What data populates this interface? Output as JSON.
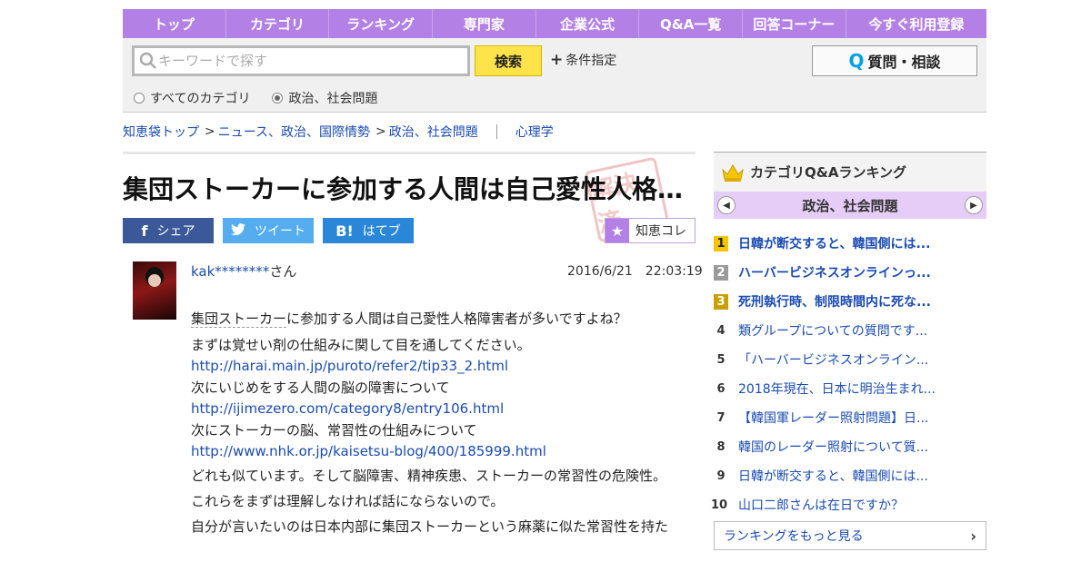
{
  "nav": {
    "items": [
      "トップ",
      "カテゴリ",
      "ランキング",
      "専門家",
      "企業公式",
      "Q&A一覧",
      "回答コーナー",
      "今すぐ利用登録"
    ]
  },
  "search": {
    "placeholder": "キーワードで探す",
    "button_label": "検索",
    "condition_label": "条件指定",
    "ask_button_label": "質問・相談",
    "scope_all": "すべてのカテゴリ",
    "scope_current": "政治、社会問題"
  },
  "breadcrumb": {
    "items": [
      "知恵袋トップ",
      "ニュース、政治、国際情勢",
      "政治、社会問題"
    ],
    "separator": ">",
    "related": "心理学"
  },
  "question": {
    "title": "集団ストーカーに参加する人間は自己愛性人格障害者が多いですよね？",
    "stamp_text": "解決済",
    "share": {
      "facebook": "シェア",
      "twitter": "ツイート",
      "hatena": "はてブ",
      "chiekore": "知恵コレ"
    },
    "user": "kak********",
    "user_suffix": "さん",
    "date": "2016/6/21　22:03:19",
    "lines": [
      {
        "text_a": "集団ストーカー",
        "text_b": "に参加する人間は自己愛性人格障害者が多いですよね？"
      },
      {
        "text": "まずは覚せい剤の仕組みに関して目を通してください。"
      },
      {
        "link": "http://harai.main.jp/puroto/refer2/tip33_2.html"
      },
      {
        "text": "次にいじめをする人間の脳の障害について"
      },
      {
        "link": "http://ijimezero.com/category8/entry106.html"
      },
      {
        "text": "次にストーカーの脳、常習性の仕組みについて"
      },
      {
        "link": "http://www.nhk.or.jp/kaisetsu-blog/400/185999.html"
      },
      {
        "text": "どれも似ています。そして脳障害、精神疾患、ストーカーの常習性の危険性。"
      },
      {
        "text": "これらをまずは理解しなければ話にならないので。"
      },
      {
        "text": "自分が言いたいのは日本内部に集団ストーカーという麻薬に似た常習性を持た"
      }
    ]
  },
  "sidebar": {
    "title": "カテゴリQ&Aランキング",
    "category": "政治、社会問題",
    "items": [
      {
        "rank": "1",
        "text": "日韓が断交すると、韓国側には..."
      },
      {
        "rank": "2",
        "text": "ハーバービジネスオンラインっ..."
      },
      {
        "rank": "3",
        "text": "死刑執行時、制限時間内に死な..."
      },
      {
        "rank": "4",
        "text": "類グループについての質問です..."
      },
      {
        "rank": "5",
        "text": "「ハーバービジネスオンライン..."
      },
      {
        "rank": "6",
        "text": "2018年現在、日本に明治生まれ..."
      },
      {
        "rank": "7",
        "text": "【韓国軍レーダー照射問題】日..."
      },
      {
        "rank": "8",
        "text": "韓国のレーダー照射について質..."
      },
      {
        "rank": "9",
        "text": "日韓が断交すると、韓国側には..."
      },
      {
        "rank": "10",
        "text": "山口二郎さんは在日ですか？"
      }
    ],
    "more_label": "ランキングをもっと見る"
  },
  "colors": {
    "nav_bg": "#b380e6",
    "link": "#1a4bb2",
    "search_button": "#ffe34a",
    "facebook": "#3b5998",
    "twitter": "#55acee",
    "hatena": "#2a86d6"
  }
}
